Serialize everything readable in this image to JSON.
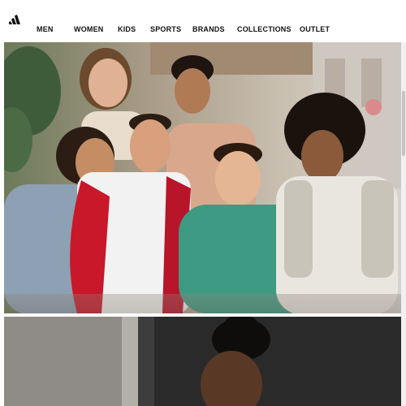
{
  "brand": {
    "logo_name": "adidas-logo"
  },
  "nav": {
    "items": [
      {
        "label": "MEN"
      },
      {
        "label": "WOMEN"
      },
      {
        "label": "KIDS"
      },
      {
        "label": "SPORTS"
      },
      {
        "label": "BRANDS"
      },
      {
        "label": "COLLECTIONS"
      },
      {
        "label": "OUTLET"
      }
    ]
  },
  "hero": {
    "image": "group-of-friends-photo"
  },
  "second_banner": {
    "image": "woman-portrait-photo"
  },
  "colors": {
    "text": "#111111",
    "background": "#ffffff"
  }
}
